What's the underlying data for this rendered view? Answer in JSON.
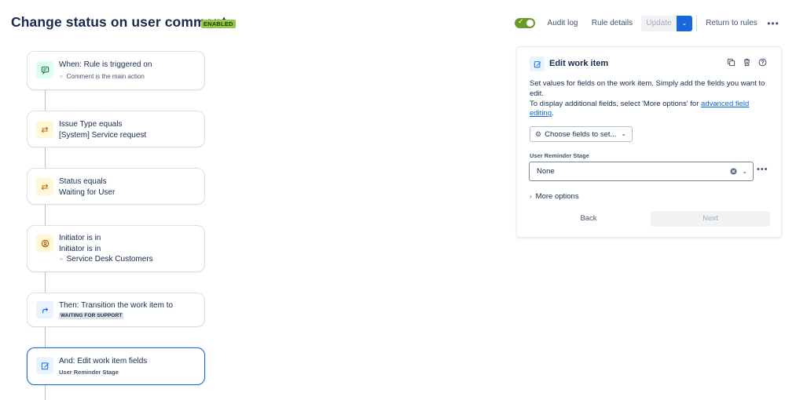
{
  "header": {
    "title": "Change status on user comment",
    "badge": "ENABLED",
    "audit_log": "Audit log",
    "rule_details": "Rule details",
    "update": "Update",
    "return_to_rules": "Return to rules"
  },
  "toggle": {
    "enabled": true
  },
  "colors": {
    "accent": "#1868db",
    "badge": "#94c748",
    "toggle": "#6a9a23"
  },
  "flow": [
    {
      "icon": "comment-icon",
      "line1": "When: Rule is triggered on",
      "sub": "Comment is the main action"
    },
    {
      "icon": "condition-icon",
      "line1": "Issue Type equals",
      "line2": "[System] Service request"
    },
    {
      "icon": "condition-icon",
      "line1": "Status equals",
      "line2": "Waiting for User"
    },
    {
      "icon": "user-condition-icon",
      "line1": "Initiator is in",
      "line2": "Initiator is in",
      "bullet": "Service Desk Customers"
    },
    {
      "icon": "transition-icon",
      "line1": "Then: Transition the work item to",
      "lozenge": "WAITING FOR SUPPORT"
    },
    {
      "icon": "edit-icon",
      "line1": "And: Edit work item fields",
      "bold_sub": "User Reminder Stage"
    }
  ],
  "panel": {
    "title": "Edit work item",
    "desc_line1": "Set values for fields on the work item. Simply add the fields you want to edit.",
    "desc_line2_prefix": "To display additional fields, select 'More options' for ",
    "desc_link": "advanced field editing",
    "desc_suffix": ".",
    "choose_fields": "Choose fields to set...",
    "field_label": "User Reminder Stage",
    "field_value": "None",
    "more_options": "More options",
    "back": "Back",
    "next": "Next"
  }
}
